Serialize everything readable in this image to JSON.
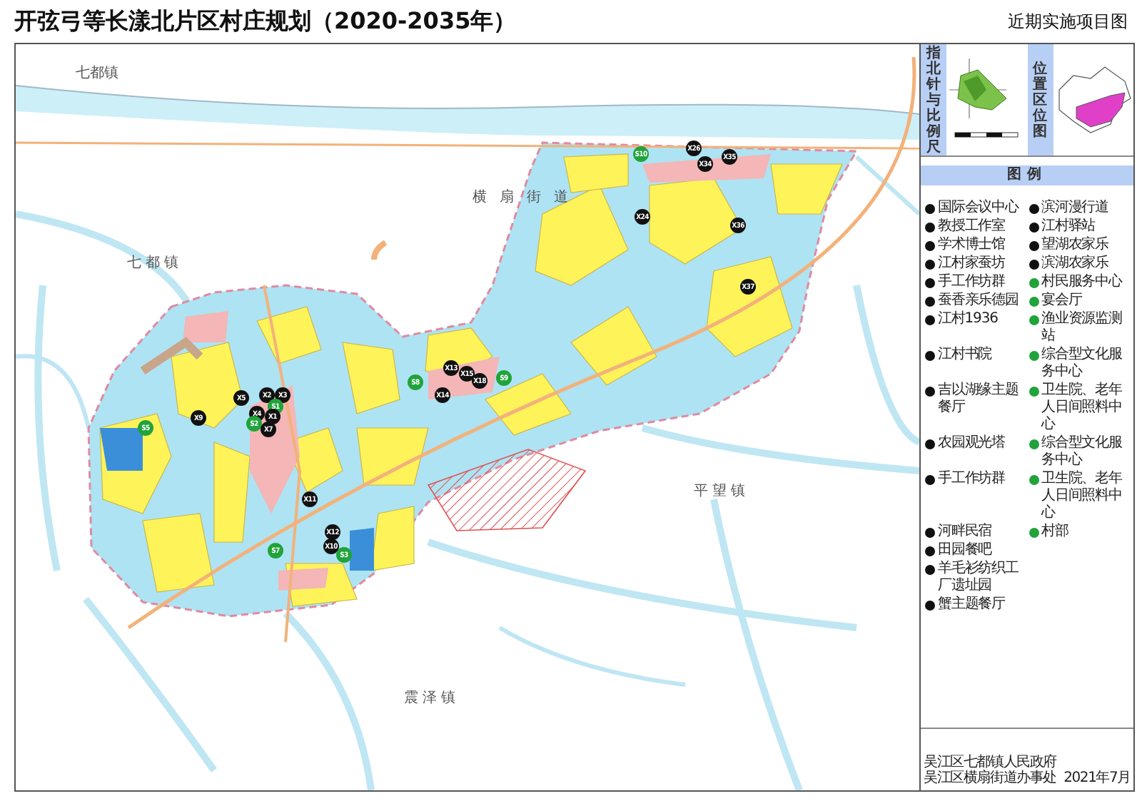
{
  "title": "开弦弓等长漾北片区村庄规划（2020-2035年）",
  "subtitle": "近期实施项目图",
  "map": {
    "places": [
      {
        "name": "七都镇"
      },
      {
        "name": "七都镇"
      },
      {
        "name": "横扇街道"
      },
      {
        "name": "平望镇"
      },
      {
        "name": "震泽镇"
      }
    ],
    "markers": [
      {
        "code": "X9",
        "kind": "project"
      },
      {
        "code": "X5",
        "kind": "project"
      },
      {
        "code": "X2",
        "kind": "project"
      },
      {
        "code": "X3",
        "kind": "project"
      },
      {
        "code": "S1",
        "kind": "service"
      },
      {
        "code": "X4",
        "kind": "project"
      },
      {
        "code": "X1",
        "kind": "project"
      },
      {
        "code": "S2",
        "kind": "service"
      },
      {
        "code": "X7",
        "kind": "project"
      },
      {
        "code": "S5",
        "kind": "service"
      },
      {
        "code": "X11",
        "kind": "project"
      },
      {
        "code": "X12",
        "kind": "project"
      },
      {
        "code": "X10",
        "kind": "project"
      },
      {
        "code": "S3",
        "kind": "service"
      },
      {
        "code": "S7",
        "kind": "service"
      },
      {
        "code": "S8",
        "kind": "service"
      },
      {
        "code": "X14",
        "kind": "project"
      },
      {
        "code": "X13",
        "kind": "project"
      },
      {
        "code": "X15",
        "kind": "project"
      },
      {
        "code": "X18",
        "kind": "project"
      },
      {
        "code": "S9",
        "kind": "service"
      },
      {
        "code": "S10",
        "kind": "service"
      },
      {
        "code": "X26",
        "kind": "project"
      },
      {
        "code": "X34",
        "kind": "project"
      },
      {
        "code": "X35",
        "kind": "project"
      },
      {
        "code": "X24",
        "kind": "project"
      },
      {
        "code": "X36",
        "kind": "project"
      },
      {
        "code": "X37",
        "kind": "project"
      }
    ]
  },
  "inset": {
    "compass_label": "指北针与比例尺",
    "location_label": "位置区位图"
  },
  "legend": {
    "title": "图例",
    "items": [
      {
        "label": "国际会议中心",
        "kind": "project"
      },
      {
        "label": "教授工作室",
        "kind": "project"
      },
      {
        "label": "学术博士馆",
        "kind": "project"
      },
      {
        "label": "江村家蚕坊",
        "kind": "project"
      },
      {
        "label": "手工作坊群",
        "kind": "project"
      },
      {
        "label": "蚕香亲乐德园",
        "kind": "project"
      },
      {
        "label": "江村1936",
        "kind": "project"
      },
      {
        "label": "江村书院",
        "kind": "project"
      },
      {
        "label": "吉以湖缘主题餐厅",
        "kind": "project"
      },
      {
        "label": "农园观光塔",
        "kind": "project"
      },
      {
        "label": "手工作坊群",
        "kind": "project"
      },
      {
        "label": "河畔民宿",
        "kind": "project"
      },
      {
        "label": "田园餐吧",
        "kind": "project"
      },
      {
        "label": "羊毛衫纺织工厂遗址园",
        "kind": "project"
      },
      {
        "label": "蟹主题餐厅",
        "kind": "project"
      },
      {
        "label": "滨河漫行道",
        "kind": "project"
      },
      {
        "label": "江村驿站",
        "kind": "project"
      },
      {
        "label": "望湖农家乐",
        "kind": "project"
      },
      {
        "label": "滨湖农家乐",
        "kind": "project"
      },
      {
        "label": "村民服务中心",
        "kind": "service"
      },
      {
        "label": "宴会厅",
        "kind": "service"
      },
      {
        "label": "渔业资源监测站",
        "kind": "service"
      },
      {
        "label": "综合型文化服务中心",
        "kind": "service"
      },
      {
        "label": "卫生院、老年人日间照料中心",
        "kind": "service"
      },
      {
        "label": "综合型文化服务中心",
        "kind": "service"
      },
      {
        "label": "卫生院、老年人日间照料中心",
        "kind": "service"
      },
      {
        "label": "村部",
        "kind": "service"
      }
    ]
  },
  "footer": {
    "issuers": [
      "吴江区七都镇人民政府",
      "吴江区横扇街道办事处"
    ],
    "date": "2021年7月"
  }
}
